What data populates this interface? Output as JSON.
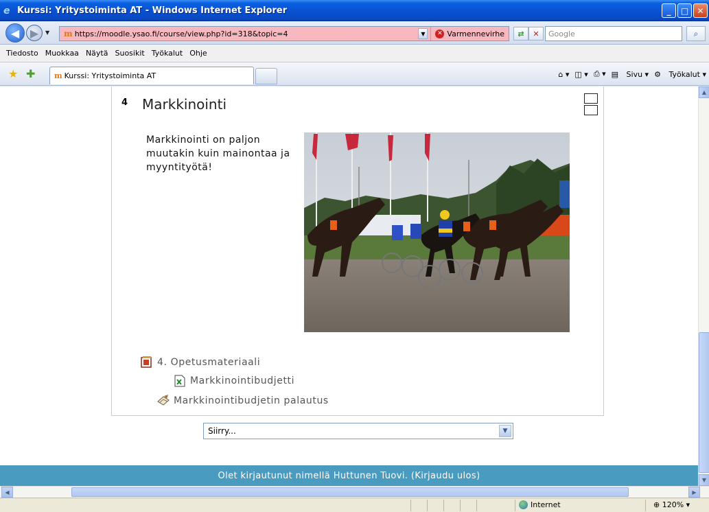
{
  "window": {
    "title": "Kurssi: Yritystoiminta AT - Windows Internet Explorer",
    "min": "_",
    "max": "□",
    "close": "✕"
  },
  "address": {
    "url": "https://moodle.ysao.fi/course/view.php?id=318&topic=4",
    "cert_warning": "Varmennevirhe",
    "search_placeholder": "Google"
  },
  "menu": [
    "Tiedosto",
    "Muokkaa",
    "Näytä",
    "Suosikit",
    "Työkalut",
    "Ohje"
  ],
  "tab": {
    "label": "Kurssi: Yritystoiminta AT"
  },
  "commandbar": {
    "page": "Sivu",
    "tools": "Työkalut"
  },
  "section": {
    "number": "4",
    "title": "Markkinointi",
    "summary": "Markkinointi on paljon muutakin kuin mainontaa ja myyntityötä!"
  },
  "activities": [
    {
      "label": "4. Opetusmateriaali",
      "icon": "presentation-icon"
    },
    {
      "label": "Markkinointibudjetti",
      "icon": "spreadsheet-icon"
    },
    {
      "label": "Markkinointibudjetin palautus",
      "icon": "assignment-icon"
    }
  ],
  "jump_menu": {
    "selected": "Siirry..."
  },
  "footer": {
    "text": "Olet kirjautunut nimellä Huttunen Tuovi. (Kirjaudu ulos)"
  },
  "status": {
    "zone": "Internet",
    "zoom": "120%"
  },
  "colors": {
    "footer_bg": "#4a9bc0",
    "cert_warning_bg": "#f8b8c0",
    "titlebar": "#0850d0"
  }
}
